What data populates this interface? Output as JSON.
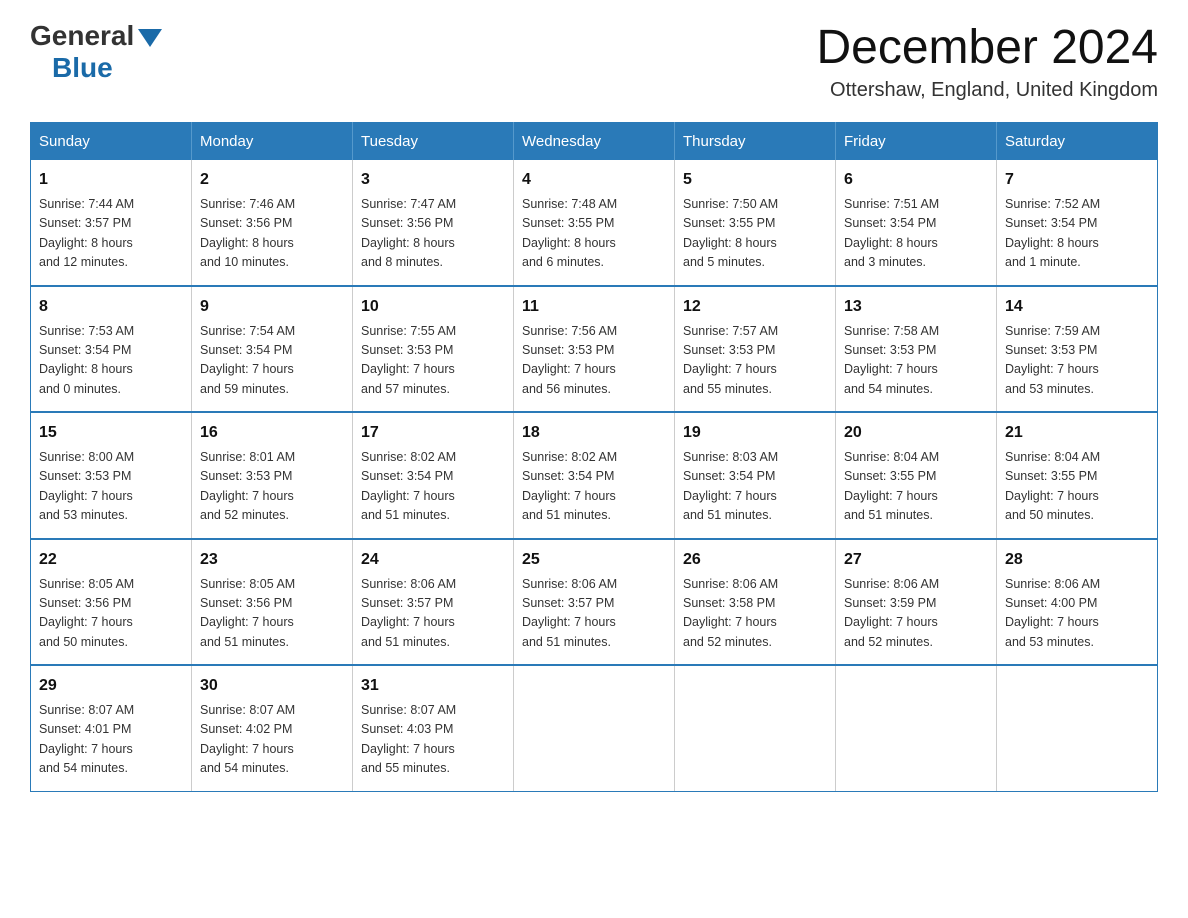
{
  "header": {
    "logo": {
      "general": "General",
      "blue": "Blue"
    },
    "title": "December 2024",
    "location": "Ottershaw, England, United Kingdom"
  },
  "calendar": {
    "days_of_week": [
      "Sunday",
      "Monday",
      "Tuesday",
      "Wednesday",
      "Thursday",
      "Friday",
      "Saturday"
    ],
    "weeks": [
      [
        {
          "day": "1",
          "info": "Sunrise: 7:44 AM\nSunset: 3:57 PM\nDaylight: 8 hours\nand 12 minutes."
        },
        {
          "day": "2",
          "info": "Sunrise: 7:46 AM\nSunset: 3:56 PM\nDaylight: 8 hours\nand 10 minutes."
        },
        {
          "day": "3",
          "info": "Sunrise: 7:47 AM\nSunset: 3:56 PM\nDaylight: 8 hours\nand 8 minutes."
        },
        {
          "day": "4",
          "info": "Sunrise: 7:48 AM\nSunset: 3:55 PM\nDaylight: 8 hours\nand 6 minutes."
        },
        {
          "day": "5",
          "info": "Sunrise: 7:50 AM\nSunset: 3:55 PM\nDaylight: 8 hours\nand 5 minutes."
        },
        {
          "day": "6",
          "info": "Sunrise: 7:51 AM\nSunset: 3:54 PM\nDaylight: 8 hours\nand 3 minutes."
        },
        {
          "day": "7",
          "info": "Sunrise: 7:52 AM\nSunset: 3:54 PM\nDaylight: 8 hours\nand 1 minute."
        }
      ],
      [
        {
          "day": "8",
          "info": "Sunrise: 7:53 AM\nSunset: 3:54 PM\nDaylight: 8 hours\nand 0 minutes."
        },
        {
          "day": "9",
          "info": "Sunrise: 7:54 AM\nSunset: 3:54 PM\nDaylight: 7 hours\nand 59 minutes."
        },
        {
          "day": "10",
          "info": "Sunrise: 7:55 AM\nSunset: 3:53 PM\nDaylight: 7 hours\nand 57 minutes."
        },
        {
          "day": "11",
          "info": "Sunrise: 7:56 AM\nSunset: 3:53 PM\nDaylight: 7 hours\nand 56 minutes."
        },
        {
          "day": "12",
          "info": "Sunrise: 7:57 AM\nSunset: 3:53 PM\nDaylight: 7 hours\nand 55 minutes."
        },
        {
          "day": "13",
          "info": "Sunrise: 7:58 AM\nSunset: 3:53 PM\nDaylight: 7 hours\nand 54 minutes."
        },
        {
          "day": "14",
          "info": "Sunrise: 7:59 AM\nSunset: 3:53 PM\nDaylight: 7 hours\nand 53 minutes."
        }
      ],
      [
        {
          "day": "15",
          "info": "Sunrise: 8:00 AM\nSunset: 3:53 PM\nDaylight: 7 hours\nand 53 minutes."
        },
        {
          "day": "16",
          "info": "Sunrise: 8:01 AM\nSunset: 3:53 PM\nDaylight: 7 hours\nand 52 minutes."
        },
        {
          "day": "17",
          "info": "Sunrise: 8:02 AM\nSunset: 3:54 PM\nDaylight: 7 hours\nand 51 minutes."
        },
        {
          "day": "18",
          "info": "Sunrise: 8:02 AM\nSunset: 3:54 PM\nDaylight: 7 hours\nand 51 minutes."
        },
        {
          "day": "19",
          "info": "Sunrise: 8:03 AM\nSunset: 3:54 PM\nDaylight: 7 hours\nand 51 minutes."
        },
        {
          "day": "20",
          "info": "Sunrise: 8:04 AM\nSunset: 3:55 PM\nDaylight: 7 hours\nand 51 minutes."
        },
        {
          "day": "21",
          "info": "Sunrise: 8:04 AM\nSunset: 3:55 PM\nDaylight: 7 hours\nand 50 minutes."
        }
      ],
      [
        {
          "day": "22",
          "info": "Sunrise: 8:05 AM\nSunset: 3:56 PM\nDaylight: 7 hours\nand 50 minutes."
        },
        {
          "day": "23",
          "info": "Sunrise: 8:05 AM\nSunset: 3:56 PM\nDaylight: 7 hours\nand 51 minutes."
        },
        {
          "day": "24",
          "info": "Sunrise: 8:06 AM\nSunset: 3:57 PM\nDaylight: 7 hours\nand 51 minutes."
        },
        {
          "day": "25",
          "info": "Sunrise: 8:06 AM\nSunset: 3:57 PM\nDaylight: 7 hours\nand 51 minutes."
        },
        {
          "day": "26",
          "info": "Sunrise: 8:06 AM\nSunset: 3:58 PM\nDaylight: 7 hours\nand 52 minutes."
        },
        {
          "day": "27",
          "info": "Sunrise: 8:06 AM\nSunset: 3:59 PM\nDaylight: 7 hours\nand 52 minutes."
        },
        {
          "day": "28",
          "info": "Sunrise: 8:06 AM\nSunset: 4:00 PM\nDaylight: 7 hours\nand 53 minutes."
        }
      ],
      [
        {
          "day": "29",
          "info": "Sunrise: 8:07 AM\nSunset: 4:01 PM\nDaylight: 7 hours\nand 54 minutes."
        },
        {
          "day": "30",
          "info": "Sunrise: 8:07 AM\nSunset: 4:02 PM\nDaylight: 7 hours\nand 54 minutes."
        },
        {
          "day": "31",
          "info": "Sunrise: 8:07 AM\nSunset: 4:03 PM\nDaylight: 7 hours\nand 55 minutes."
        },
        null,
        null,
        null,
        null
      ]
    ]
  }
}
